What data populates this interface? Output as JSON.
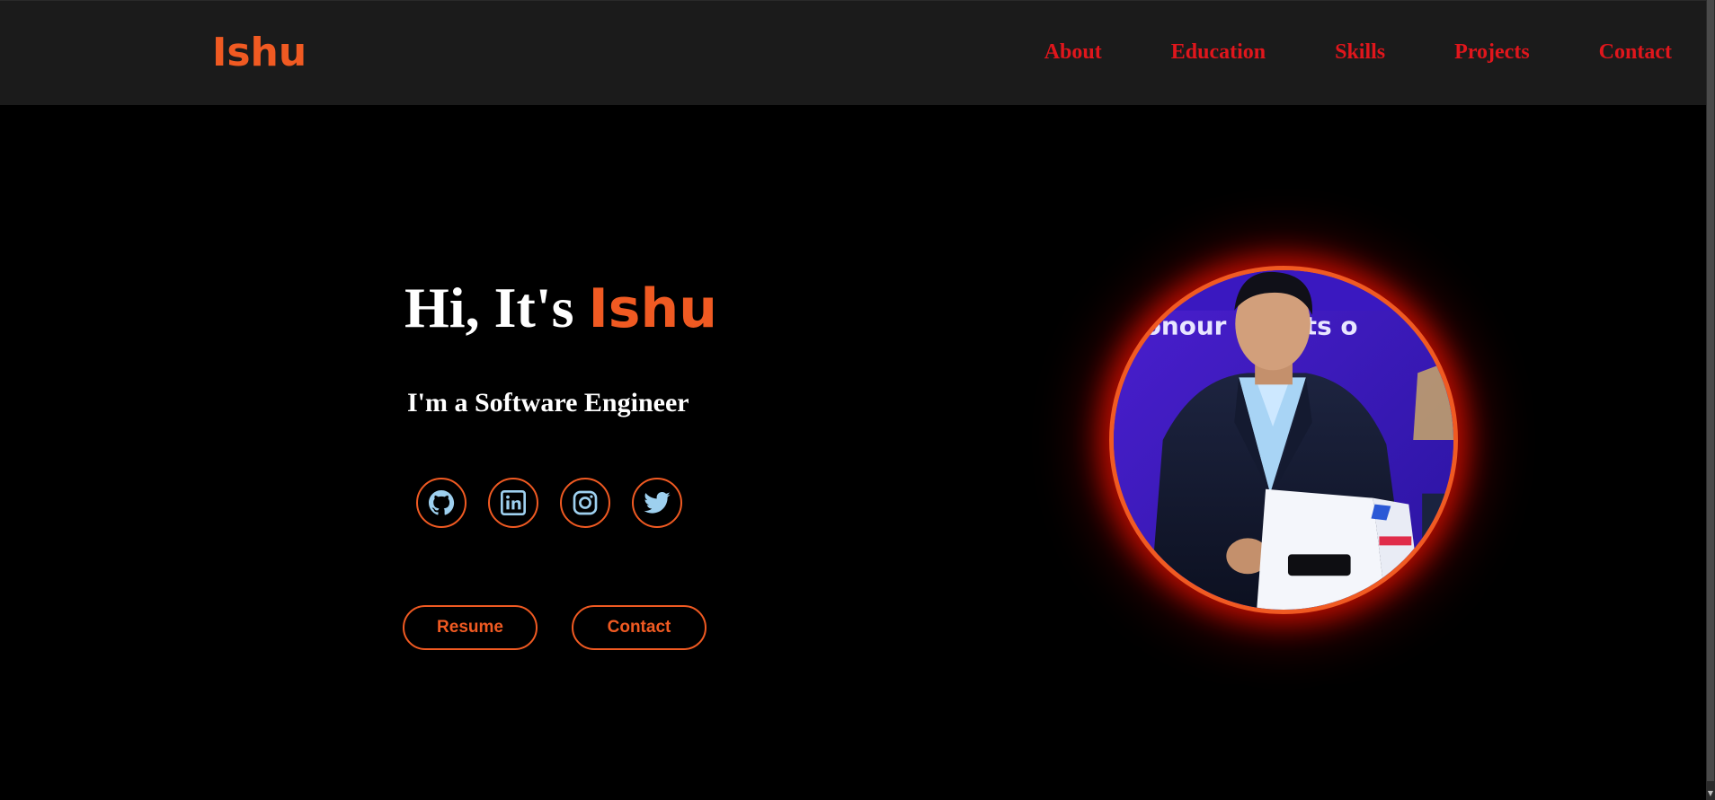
{
  "header": {
    "logo": "Ishu",
    "nav": [
      "About",
      "Education",
      "Skills",
      "Projects",
      "Contact"
    ]
  },
  "hero": {
    "greeting_prefix": "Hi, It's ",
    "greeting_name": "Ishu",
    "role": "I'm a Software Engineer",
    "socials": [
      {
        "icon": "github-icon"
      },
      {
        "icon": "linkedin-icon"
      },
      {
        "icon": "instagram-icon"
      },
      {
        "icon": "twitter-icon"
      }
    ],
    "buttons": {
      "resume": "Resume",
      "contact": "Contact"
    }
  },
  "profile_photo": {
    "banner_text": "nonour   ipients o"
  },
  "colors": {
    "accent": "#f05a22",
    "nav": "#e0161c",
    "header_bg": "#1b1b1b",
    "icon": "#9ed0ef",
    "background": "#000000"
  }
}
